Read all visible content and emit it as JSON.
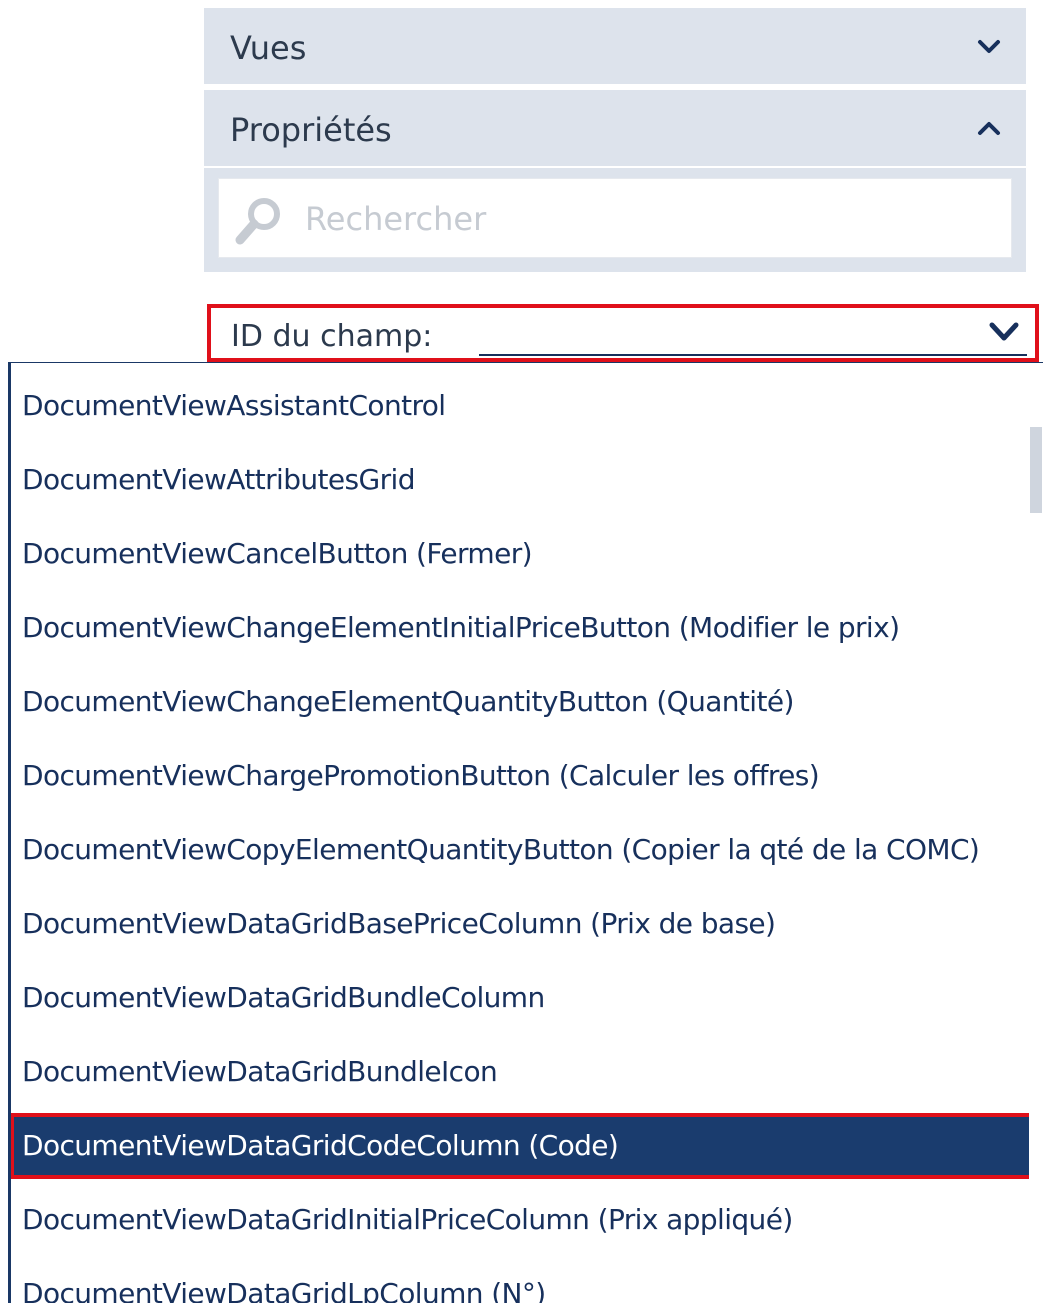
{
  "panels": {
    "vues": {
      "title": "Vues",
      "state": "collapsed"
    },
    "proprietes": {
      "title": "Propriétés",
      "state": "expanded"
    }
  },
  "search": {
    "placeholder": "Rechercher",
    "value": ""
  },
  "field": {
    "label": "ID du champ:",
    "selected_value": ""
  },
  "dropdown": {
    "items": [
      "DocumentViewAssistantControl",
      "DocumentViewAttributesGrid",
      "DocumentViewCancelButton (Fermer)",
      "DocumentViewChangeElementInitialPriceButton (Modifier le prix)",
      "DocumentViewChangeElementQuantityButton (Quantité)",
      "DocumentViewChargePromotionButton (Calculer les offres)",
      "DocumentViewCopyElementQuantityButton (Copier la qté de la COMC)",
      "DocumentViewDataGridBasePriceColumn (Prix de base)",
      "DocumentViewDataGridBundleColumn",
      "DocumentViewDataGridBundleIcon",
      "DocumentViewDataGridCodeColumn (Code)",
      "DocumentViewDataGridInitialPriceColumn (Prix appliqué)",
      "DocumentViewDataGridLpColumn (N°)"
    ],
    "selected_index": 10
  },
  "colors": {
    "header_bg": "#dde3ec",
    "text_dark": "#2c3a4d",
    "item_text": "#17305c",
    "selected_bg": "#1a3c6e",
    "highlight_border": "#e0101a"
  },
  "icons": {
    "vues_toggle": "chevron-down-icon",
    "proprietes_toggle": "chevron-up-icon",
    "search": "search-icon",
    "field_dropdown": "chevron-down-icon"
  }
}
